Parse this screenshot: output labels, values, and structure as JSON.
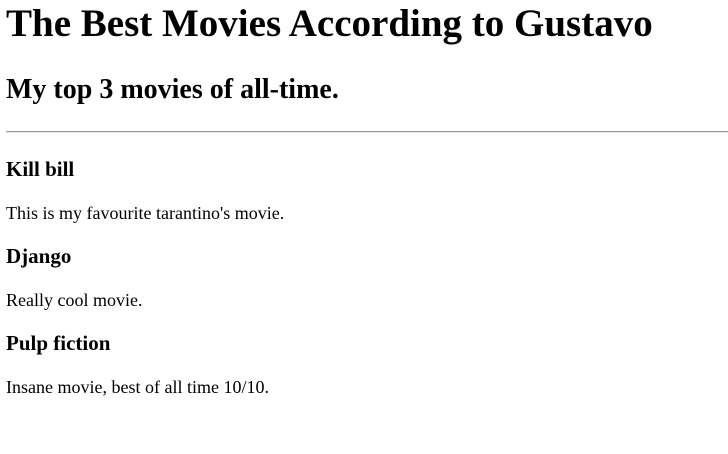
{
  "header": {
    "title": "The Best Movies According to Gustavo",
    "subtitle": "My top 3 movies of all-time."
  },
  "movies": [
    {
      "title": "Kill bill",
      "description": "This is my favourite tarantino's movie."
    },
    {
      "title": "Django",
      "description": "Really cool movie."
    },
    {
      "title": "Pulp fiction",
      "description": "Insane movie, best of all time 10/10."
    }
  ]
}
